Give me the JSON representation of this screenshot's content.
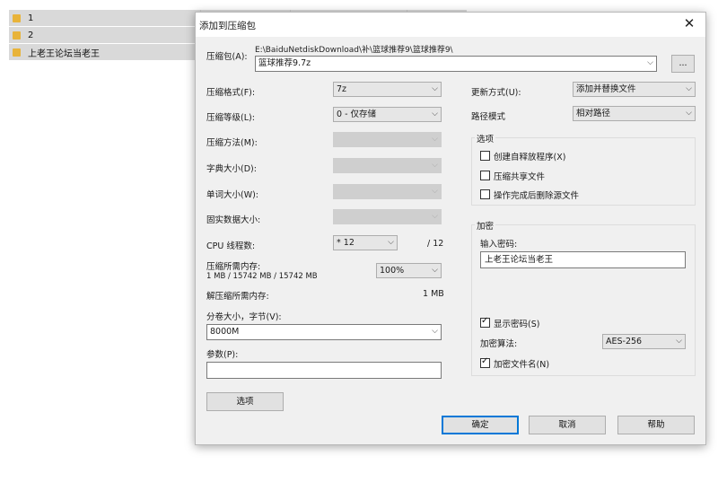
{
  "file_list": [
    {
      "name": "1"
    },
    {
      "name": "2"
    },
    {
      "name": "上老王论坛当老王"
    }
  ],
  "dialog": {
    "title": "添加到压缩包",
    "archive": {
      "label": "压缩包(A):",
      "path": "E:\\BaiduNetdiskDownload\\补\\篮球推荐9\\篮球推荐9\\",
      "name": "篮球推荐9.7z",
      "browse_label": "..."
    },
    "format": {
      "label": "压缩格式(F):",
      "value": "7z"
    },
    "level": {
      "label": "压缩等级(L):",
      "value": "0 - 仅存储"
    },
    "method": {
      "label": "压缩方法(M):"
    },
    "dict": {
      "label": "字典大小(D):"
    },
    "word": {
      "label": "单词大小(W):"
    },
    "solid": {
      "label": "固实数据大小:"
    },
    "threads": {
      "label": "CPU 线程数:",
      "value": "* 12",
      "max": "/ 12"
    },
    "mem_compress": {
      "label": "压缩所需内存:",
      "detail": "1 MB / 15742 MB / 15742 MB",
      "percent": "100%"
    },
    "mem_decompress": {
      "label": "解压缩所需内存:",
      "value": "1 MB"
    },
    "volume": {
      "label": "分卷大小，字节(V):",
      "value": "8000M"
    },
    "params": {
      "label": "参数(P):",
      "value": ""
    },
    "options_button": "选项",
    "update_mode": {
      "label": "更新方式(U):",
      "value": "添加并替换文件"
    },
    "path_mode": {
      "label": "路径模式",
      "value": "相对路径"
    },
    "options_group": {
      "title": "选项",
      "sfx": {
        "label": "创建自释放程序(X)",
        "checked": false
      },
      "shared": {
        "label": "压缩共享文件",
        "checked": false
      },
      "delete_after": {
        "label": "操作完成后删除源文件",
        "checked": false
      }
    },
    "encryption": {
      "title": "加密",
      "password_label": "输入密码:",
      "password": "上老王论坛当老王",
      "show_password": {
        "label": "显示密码(S)",
        "checked": true
      },
      "method_label": "加密算法:",
      "method_value": "AES-256",
      "encrypt_names": {
        "label": "加密文件名(N)",
        "checked": true
      }
    },
    "buttons": {
      "ok": "确定",
      "cancel": "取消",
      "help": "帮助"
    }
  }
}
